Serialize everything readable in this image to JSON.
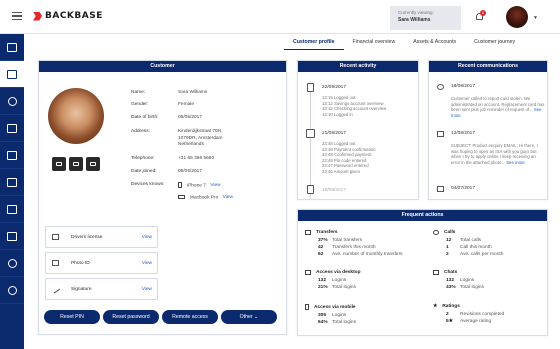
{
  "header": {
    "logo": "BACKBASE",
    "viewing_label": "Currently viewing:",
    "viewing_name": "Sara Williams",
    "notification_count": "6"
  },
  "tabs": [
    {
      "label": "Customer profile"
    },
    {
      "label": "Financial overview"
    },
    {
      "label": "Assets & Accounts"
    },
    {
      "label": "Customer journey"
    }
  ],
  "customer": {
    "title": "Customer",
    "info": [
      {
        "label": "Name:",
        "value": "Sara Williams"
      },
      {
        "label": "Gender:",
        "value": "Female"
      },
      {
        "label": "Date of birth:",
        "value": "05/05/2017"
      },
      {
        "label": "Address:",
        "value": "Kinderdijkstraat 70H,",
        "value2": "1079DR, Amsterdam",
        "value3": "Netherlands"
      },
      {
        "label": "Telephone:",
        "value": "+31 65 356 5680"
      },
      {
        "label": "Date joined:",
        "value": "05/05/2017"
      },
      {
        "label": "Devices known:",
        "value": "iPhone 7",
        "view": "View"
      }
    ],
    "device2": {
      "value": "Macbook Pro",
      "view": "View"
    },
    "documents": [
      {
        "label": "Drivers license",
        "view": "View"
      },
      {
        "label": "Photo ID",
        "view": "View"
      },
      {
        "label": "Signature",
        "view": "View"
      }
    ],
    "actions": [
      "Reset PIN",
      "Reset password",
      "Remote access",
      "Other"
    ]
  },
  "recent_activity": {
    "title": "Recent activity",
    "groups": [
      {
        "date": "22/09/2017",
        "events": [
          "13:15 Logged out",
          "13:12 Savings account overview",
          "13:12 Checking account overview",
          "13:10 Logged in"
        ]
      },
      {
        "date": "21/09/2017",
        "events": [
          "23:48 Logged out",
          "23:48 Payment confirmation",
          "23:48 Confirmed payment",
          "23:48 Pin code entered",
          "23:47 Password entered",
          "23:46 Amount given"
        ]
      },
      {
        "date": "18/09/2017",
        "events": []
      }
    ]
  },
  "recent_communications": {
    "title": "Recent communications",
    "items": [
      {
        "date": "18/08/2017",
        "text": "Customer called to report card stolen. We administrated on account. Replacement card has been sent plus job reminder of request of...",
        "more": "See more"
      },
      {
        "date": "12/08/2017",
        "text": "SUBJECT: Product enquiry EMAIL: Hi there, I was hoping to open an ISA with you guys but when I try to apply online I keep receiving an error in the attached photo...",
        "more": "See more"
      },
      {
        "date": "04/07/2017",
        "text": "",
        "more": ""
      }
    ]
  },
  "frequent_actions": {
    "title": "Frequent actions",
    "sections": [
      {
        "title": "Transfers",
        "rows": [
          {
            "n": "37%",
            "t": "Total transfers"
          },
          {
            "n": "42",
            "t": "Transfers this month"
          },
          {
            "n": "62",
            "t": "Ave. number of monthly transfers"
          }
        ]
      },
      {
        "title": "Calls",
        "rows": [
          {
            "n": "12",
            "t": "Total calls"
          },
          {
            "n": "1",
            "t": "Call this month"
          },
          {
            "n": "2",
            "t": "Ave. calls per month"
          }
        ]
      },
      {
        "title": "Access via desktop",
        "rows": [
          {
            "n": "132",
            "t": "Logins"
          },
          {
            "n": "21%",
            "t": "Total logins"
          }
        ]
      },
      {
        "title": "Chats",
        "rows": [
          {
            "n": "132",
            "t": "Logins"
          },
          {
            "n": "43%",
            "t": "Total logins"
          }
        ]
      },
      {
        "title": "Access via mobile",
        "rows": [
          {
            "n": "305",
            "t": "Logins"
          },
          {
            "n": "64%",
            "t": "Total logins"
          }
        ]
      },
      {
        "title": "Ratings",
        "rows": [
          {
            "n": "2",
            "t": "Revisions completed"
          },
          {
            "n": "5★",
            "t": "Average rating"
          }
        ]
      }
    ]
  },
  "colors": {
    "primary": "#0b2a6e",
    "accent": "#e0282e",
    "link": "#1e5bc6"
  }
}
